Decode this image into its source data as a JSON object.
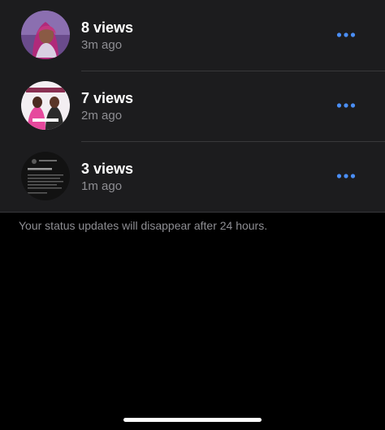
{
  "colors": {
    "accent": "#4a8ef5",
    "row_background": "#1c1c1e",
    "secondary_text": "#8e8e93",
    "page_background": "#000000"
  },
  "status_updates": [
    {
      "views": "8 views",
      "time": "3m ago",
      "thumbnail": "portrait-photo"
    },
    {
      "views": "7 views",
      "time": "2m ago",
      "thumbnail": "magazine-cover"
    },
    {
      "views": "3 views",
      "time": "1m ago",
      "thumbnail": "screenshot-of-post"
    }
  ],
  "footer_note": "Your status updates will disappear after 24 hours.",
  "icons": {
    "more": "more-horizontal-icon"
  }
}
